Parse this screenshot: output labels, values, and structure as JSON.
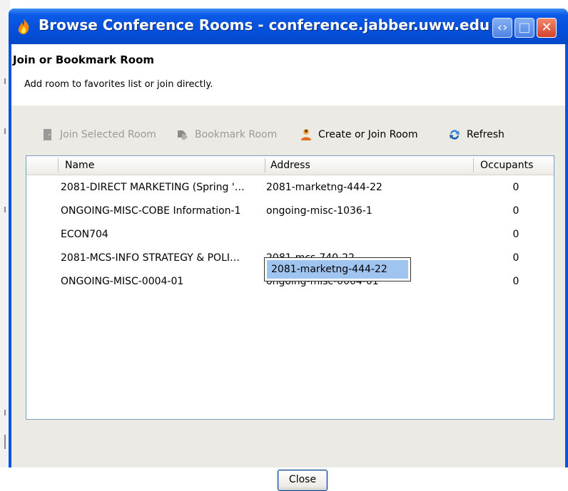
{
  "window": {
    "title": "Browse Conference Rooms - conference.jabber.uww.edu"
  },
  "header": {
    "title": "Join or Bookmark Room",
    "subtitle": "Add room to favorites list or join directly."
  },
  "toolbar": {
    "join_label": "Join Selected Room",
    "bookmark_label": "Bookmark Room",
    "create_label": "Create or Join Room",
    "refresh_label": "Refresh"
  },
  "table": {
    "columns": [
      "Name",
      "Address",
      "Occupants"
    ],
    "rows": [
      {
        "name": "2081-DIRECT MARKETING (Spring '…",
        "address": "2081-marketng-444-22",
        "occupants": "0"
      },
      {
        "name": "ONGOING-MISC-COBE Information-1",
        "address": "ongoing-misc-1036-1",
        "occupants": "0"
      },
      {
        "name": "ECON704",
        "address": "",
        "occupants": "0"
      },
      {
        "name": "2081-MCS-INFO STRATEGY & POLI…",
        "address": "2081-mcs-740-22",
        "occupants": "0"
      },
      {
        "name": "ONGOING-MISC-0004-01",
        "address": "ongoing-misc-0004-01",
        "occupants": "0"
      }
    ],
    "tooltip_value": "2081-marketng-444-22"
  },
  "footer": {
    "close_label": "Close"
  },
  "colors": {
    "titlebar": "#0550db",
    "client_bg": "#ebeae4",
    "selection": "#9fc4ef"
  },
  "icons": {
    "title": "flame-icon",
    "join": "door-icon",
    "bookmark": "bookmark-icon",
    "create": "person-icon",
    "refresh": "refresh-icon"
  }
}
